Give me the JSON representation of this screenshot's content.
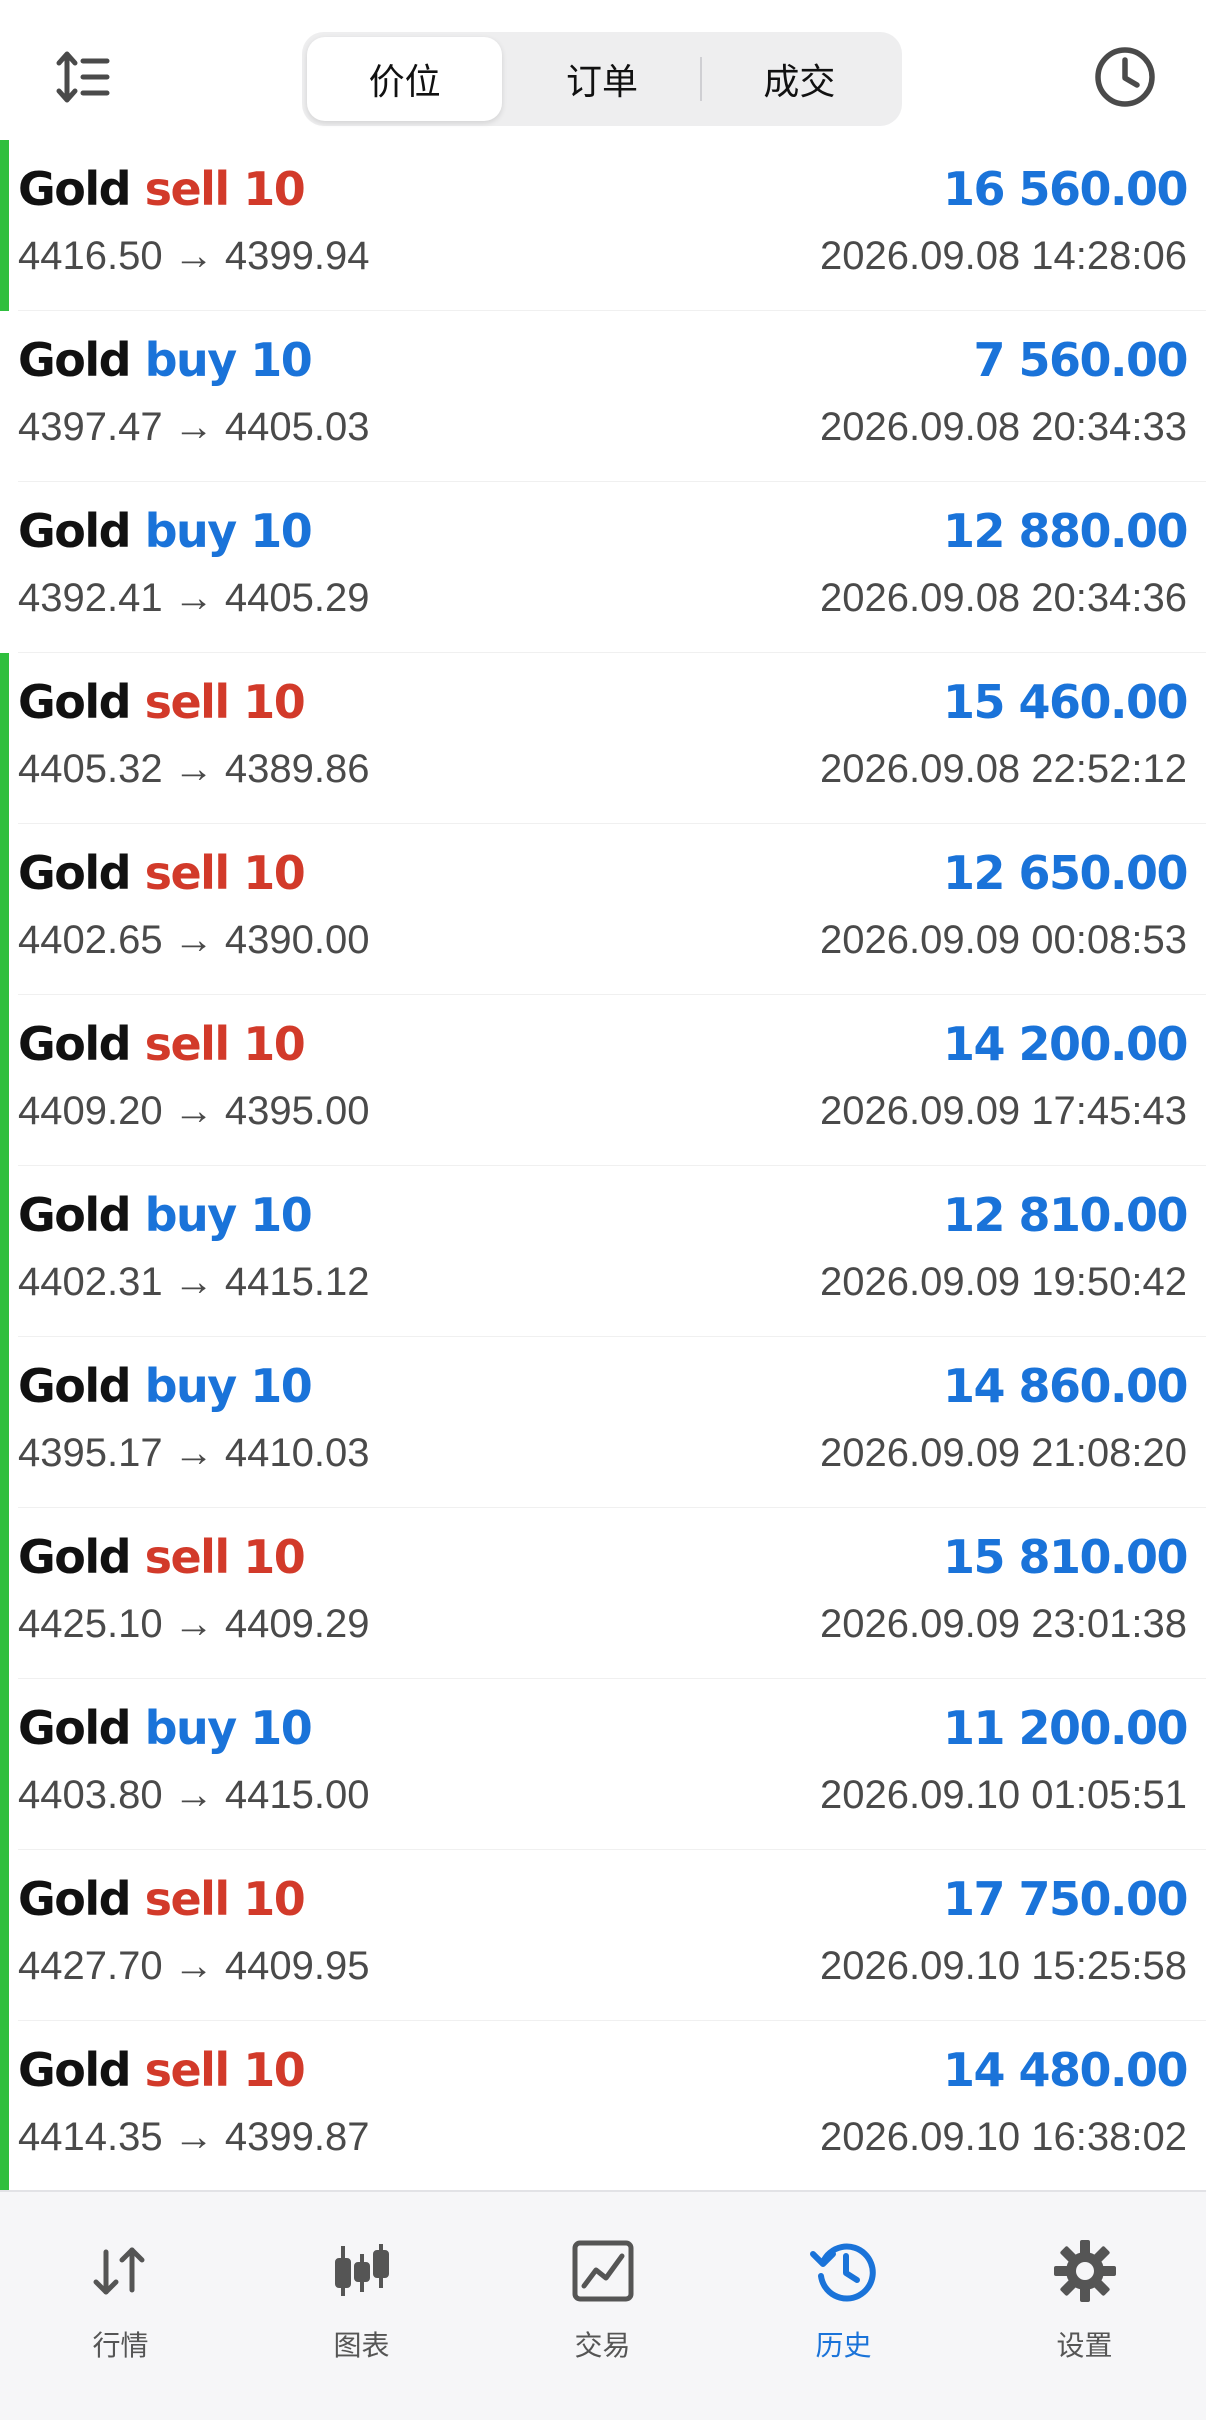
{
  "header": {
    "sort_icon": "sort-up-down-icon",
    "history_icon": "clock-icon",
    "segments": [
      {
        "label": "价位",
        "active": true
      },
      {
        "label": "订单",
        "active": false
      },
      {
        "label": "成交",
        "active": false
      }
    ]
  },
  "colors": {
    "accent_blue": "#1a73d9",
    "sell_red": "#d23a2a",
    "marker_green": "#2fbf3e"
  },
  "deals": [
    {
      "symbol": "Gold",
      "side": "sell",
      "volume": "10",
      "profit": "16 560.00",
      "open": "4416.50",
      "close": "4399.94",
      "time": "2026.09.08 14:28:06",
      "marker": true
    },
    {
      "symbol": "Gold",
      "side": "buy",
      "volume": "10",
      "profit": "7 560.00",
      "open": "4397.47",
      "close": "4405.03",
      "time": "2026.09.08 20:34:33",
      "marker": false
    },
    {
      "symbol": "Gold",
      "side": "buy",
      "volume": "10",
      "profit": "12 880.00",
      "open": "4392.41",
      "close": "4405.29",
      "time": "2026.09.08 20:34:36",
      "marker": false
    },
    {
      "symbol": "Gold",
      "side": "sell",
      "volume": "10",
      "profit": "15 460.00",
      "open": "4405.32",
      "close": "4389.86",
      "time": "2026.09.08 22:52:12",
      "marker": true
    },
    {
      "symbol": "Gold",
      "side": "sell",
      "volume": "10",
      "profit": "12 650.00",
      "open": "4402.65",
      "close": "4390.00",
      "time": "2026.09.09 00:08:53",
      "marker": true
    },
    {
      "symbol": "Gold",
      "side": "sell",
      "volume": "10",
      "profit": "14 200.00",
      "open": "4409.20",
      "close": "4395.00",
      "time": "2026.09.09 17:45:43",
      "marker": true
    },
    {
      "symbol": "Gold",
      "side": "buy",
      "volume": "10",
      "profit": "12 810.00",
      "open": "4402.31",
      "close": "4415.12",
      "time": "2026.09.09 19:50:42",
      "marker": true
    },
    {
      "symbol": "Gold",
      "side": "buy",
      "volume": "10",
      "profit": "14 860.00",
      "open": "4395.17",
      "close": "4410.03",
      "time": "2026.09.09 21:08:20",
      "marker": true
    },
    {
      "symbol": "Gold",
      "side": "sell",
      "volume": "10",
      "profit": "15 810.00",
      "open": "4425.10",
      "close": "4409.29",
      "time": "2026.09.09 23:01:38",
      "marker": true
    },
    {
      "symbol": "Gold",
      "side": "buy",
      "volume": "10",
      "profit": "11 200.00",
      "open": "4403.80",
      "close": "4415.00",
      "time": "2026.09.10 01:05:51",
      "marker": true
    },
    {
      "symbol": "Gold",
      "side": "sell",
      "volume": "10",
      "profit": "17 750.00",
      "open": "4427.70",
      "close": "4409.95",
      "time": "2026.09.10 15:25:58",
      "marker": true
    },
    {
      "symbol": "Gold",
      "side": "sell",
      "volume": "10",
      "profit": "14 480.00",
      "open": "4414.35",
      "close": "4399.87",
      "time": "2026.09.10 16:38:02",
      "marker": true
    }
  ],
  "arrow": "→",
  "tabbar": {
    "items": [
      {
        "label": "行情",
        "icon": "quotes-arrows-icon",
        "active": false
      },
      {
        "label": "图表",
        "icon": "candlestick-chart-icon",
        "active": false
      },
      {
        "label": "交易",
        "icon": "trade-chart-icon",
        "active": false
      },
      {
        "label": "历史",
        "icon": "history-clock-icon",
        "active": true
      },
      {
        "label": "设置",
        "icon": "gear-icon",
        "active": false
      }
    ]
  }
}
